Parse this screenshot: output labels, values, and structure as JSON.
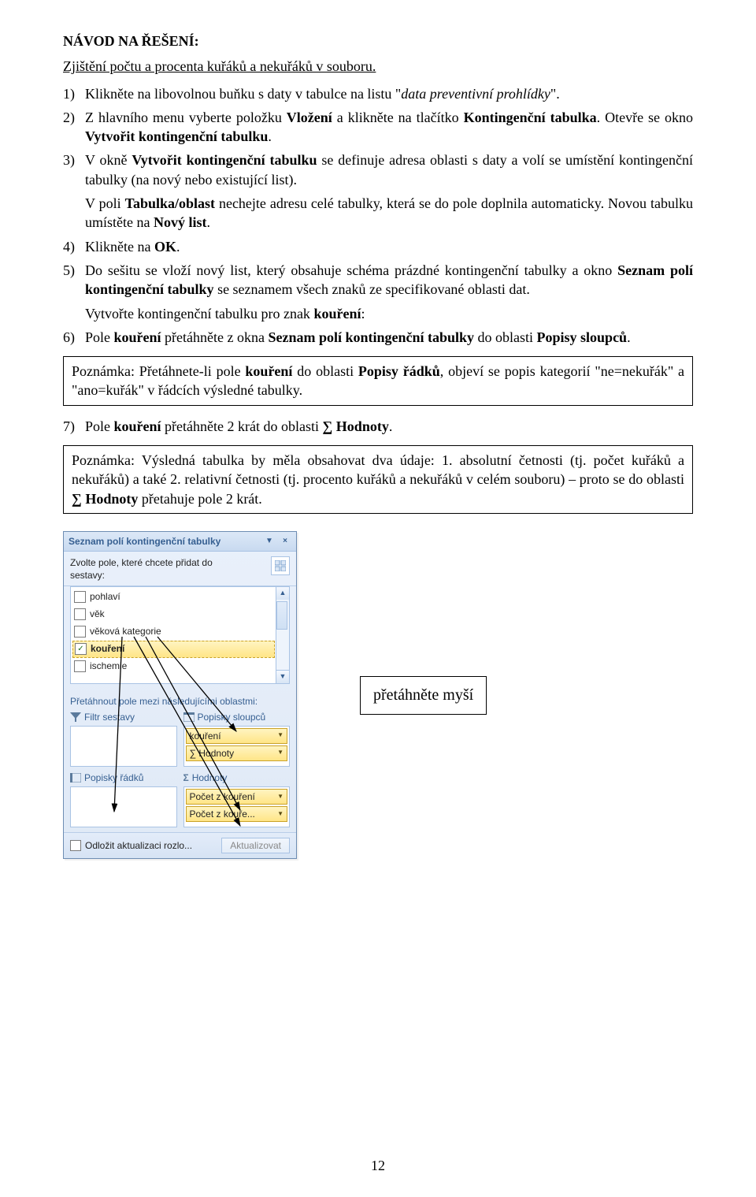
{
  "title": "NÁVOD NA ŘEŠENÍ:",
  "subtitle": "Zjištění počtu a procenta kuřáků a nekuřáků v souboru.",
  "steps": {
    "s1_a": "Klikněte na libovolnou buňku s daty v tabulce na listu \"",
    "s1_i": "data preventivní prohlídky",
    "s1_b": "\".",
    "s2_a": "Z hlavního menu vyberte položku ",
    "s2_b1": "Vložení",
    "s2_c": " a klikněte na tlačítko ",
    "s2_b2": "Kontingenční tabulka",
    "s2_d": ". Otevře se okno ",
    "s2_b3": "Vytvořit kontingenční tabulku",
    "s2_e": ".",
    "s3_a": "V okně ",
    "s3_b1": "Vytvořit kontingenční tabulku",
    "s3_b": " se definuje adresa oblasti s daty a volí se umístění kontingenční tabulky (na nový nebo existující list).",
    "s3p2_a": "V poli ",
    "s3p2_b1": "Tabulka/oblast",
    "s3p2_b": " nechejte adresu celé tabulky, která se do pole doplnila automaticky. Novou tabulku umístěte na ",
    "s3p2_b2": "Nový list",
    "s3p2_c": ".",
    "s4_a": "Klikněte na ",
    "s4_b": "OK",
    "s4_c": ".",
    "s5_a": "Do sešitu se vloží nový list, který obsahuje schéma prázdné kontingenční tabulky a okno ",
    "s5_b1": "Seznam polí kontingenční tabulky",
    "s5_b": " se seznamem všech znaků ze specifikované oblasti dat.",
    "s5p2_a": "Vytvořte kontingenční tabulku pro znak ",
    "s5p2_b": "kouření",
    "s5p2_c": ":",
    "s6_a": "Pole ",
    "s6_b1": "kouření",
    "s6_b": " přetáhněte z okna ",
    "s6_b2": "Seznam polí kontingenční tabulky",
    "s6_c": " do oblasti ",
    "s6_b3": "Popisy sloupců",
    "s6_d": "."
  },
  "note1": {
    "a": "Poznámka: Přetáhnete-li pole ",
    "b1": "kouření",
    "b": " do oblasti ",
    "b2": "Popisy řádků",
    "c": ", objeví se popis kategorií \"ne=nekuřák\" a \"ano=kuřák\" v řádcích výsledné tabulky."
  },
  "step7": {
    "num": "7)",
    "a": "Pole ",
    "b1": "kouření",
    "b": " přetáhněte 2 krát do oblasti ",
    "b2": "∑ Hodnoty",
    "c": "."
  },
  "note2": {
    "a": "Poznámka: Výsledná tabulka by měla obsahovat dva údaje: 1. absolutní četnosti (tj. počet kuřáků a nekuřáků) a také 2. relativní četnosti (tj. procento kuřáků a nekuřáků v celém souboru) – proto se do oblasti ",
    "b": "∑ Hodnoty",
    "c": " přetahuje pole 2 krát."
  },
  "callout": "přetáhněte myší",
  "pane": {
    "title": "Seznam polí kontingenční tabulky",
    "choose": "Zvolte pole, které chcete přidat do\nsestavy:",
    "fields": {
      "f0": {
        "label": "pohlaví",
        "checked": " "
      },
      "f1": {
        "label": "věk",
        "checked": " "
      },
      "f2": {
        "label": "věková kategorie",
        "checked": " "
      },
      "f3": {
        "label": "kouření",
        "checked": "✓"
      },
      "f4": {
        "label": "ischemie",
        "checked": " "
      }
    },
    "drag_label": "Přetáhnout pole mezi následujícími oblastmi:",
    "areas": {
      "filter": "Filtr sestavy",
      "cols": "Popisky sloupců",
      "rows": "Popisky řádků",
      "vals": "Hodnoty"
    },
    "cols_items": {
      "i0": "kouření",
      "i1": "∑ Hodnoty"
    },
    "vals_items": {
      "i0": "Počet z kouření",
      "i1": "Počet z kouře..."
    },
    "defer": "Odložit aktualizaci rozlo...",
    "update": "Aktualizovat"
  },
  "pagenum": "12"
}
